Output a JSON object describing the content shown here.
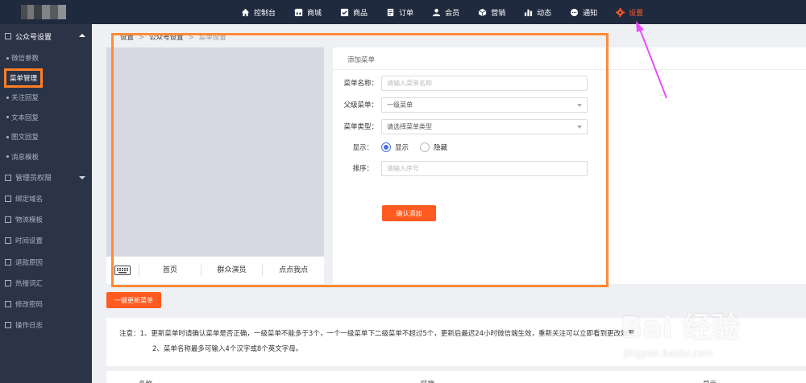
{
  "topnav": {
    "items": [
      {
        "label": "控制台",
        "icon": "home-icon"
      },
      {
        "label": "商城",
        "icon": "store-icon"
      },
      {
        "label": "商品",
        "icon": "goods-icon"
      },
      {
        "label": "订单",
        "icon": "order-icon"
      },
      {
        "label": "会员",
        "icon": "user-icon"
      },
      {
        "label": "营销",
        "icon": "marketing-box-icon"
      },
      {
        "label": "动态",
        "icon": "chart-icon"
      },
      {
        "label": "通知",
        "icon": "chat-icon"
      },
      {
        "label": "设置",
        "icon": "gear-icon"
      }
    ],
    "active_color": "#ff5a2b"
  },
  "sidebar": {
    "group_open": "公众号设置",
    "sub_items": [
      "微信参数",
      "菜单管理",
      "关注回复",
      "文本回复",
      "图文回复",
      "消息模板"
    ],
    "group_closed": "管理员权限",
    "items": [
      "绑定域名",
      "物流模板",
      "时间设置",
      "退款原因",
      "热搜词汇",
      "修改密码",
      "操作日志"
    ]
  },
  "breadcrumb": {
    "root": "设置",
    "sep": ">",
    "mid": "公众号设置",
    "current": "菜单设置"
  },
  "phone": {
    "menus": [
      "首页",
      "群众演员",
      "点点我点"
    ]
  },
  "form": {
    "title": "添加菜单",
    "name_label": "菜单名称：",
    "name_placeholder": "请输入菜单名称",
    "parent_label": "父级菜单：",
    "parent_value": "一级菜单",
    "type_label": "菜单类型：",
    "type_placeholder": "请选择菜单类型",
    "display_label": "显示：",
    "show_label": "显示",
    "hide_label": "隐藏",
    "sort_label": "排序：",
    "sort_placeholder": "请输入序号",
    "confirm_label": "确认添加"
  },
  "update_button": "一键更新菜单",
  "notes": {
    "line1": "注意：1、更新菜单时请确认菜单是否正确，一级菜单不能多于3个，一个一级菜单下二级菜单不超过5个，更新后最迟24小时微信端生效，重新关注可以立即看到更改效果",
    "line2": "2、菜单名称最多可输入4个汉字或8个英文字母。"
  },
  "table_headers": [
    "名称",
    "链接",
    "显示"
  ],
  "watermark": {
    "logo": "Bai 经验",
    "url": "jingyan.baidu.com"
  }
}
